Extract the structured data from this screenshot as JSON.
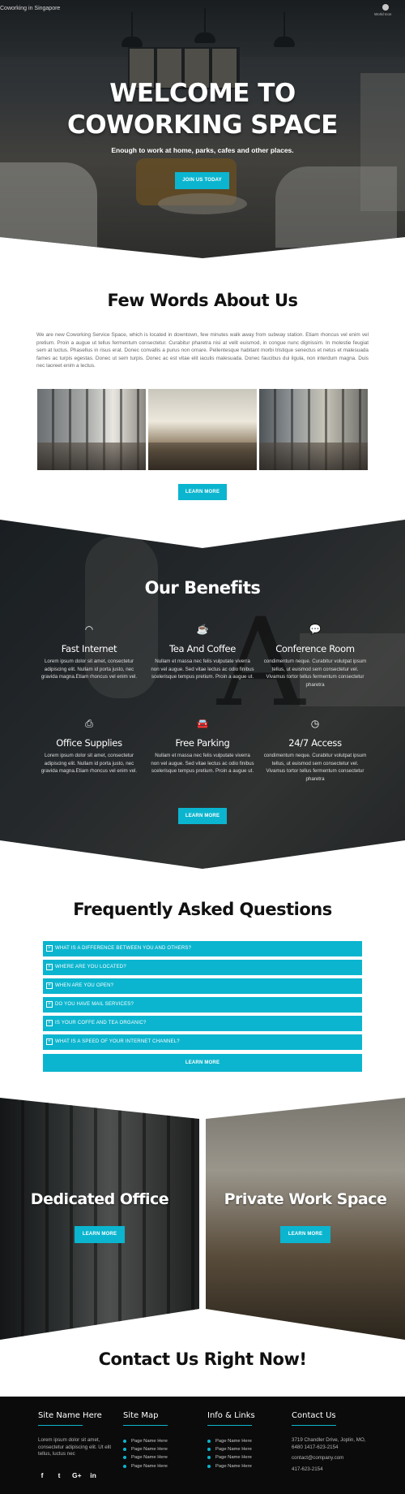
{
  "header": {
    "brand": "Coworking in Singapore",
    "top_icon_label": "World Icon"
  },
  "hero": {
    "title_line1": "WELCOME TO",
    "title_line2": "COWORKING SPACE",
    "subtitle": "Enough to work at home, parks, cafes and other places.",
    "button": "JOIN US TODAY"
  },
  "about": {
    "title": "Few Words About Us",
    "text": "We are new Coworking Service Space, which is located in downtown, few minutes walk away from subway station. Etiam rhoncus vel enim vel pretium. Proin a augue ut tellus fermentum consectetur. Curabitur pharetra nisi at velit euismod, in congue nunc dignissim. In molestie feugiat sem at luctus. Phasellus in risus erat. Donec convallis a purus non ornare. Pellentesque habitant morbi tristique senectus et netus et malesuada fames ac turpis egestas. Donec ut sem turpis. Donec ac est vitae elit iaculis malesuada. Donec faucibus dui ligula, non interdum magna. Duis nec laoreet enim a lectus.",
    "button": "LEARN MORE"
  },
  "benefits": {
    "title": "Our Benefits",
    "items": [
      {
        "icon": "wifi-icon",
        "glyph": "◠",
        "title": "Fast Internet",
        "text": "Lorem ipsum dolor sit amet, consectetur adipiscing elit. Nullam id porta justo, nec gravida magna.Etiam rhoncus vel enim vel."
      },
      {
        "icon": "coffee-icon",
        "glyph": "☕",
        "title": "Tea And Coffee",
        "text": "Nullam et massa nec felis vulputate viverra non vel augue. Sed vitae lectus ac odio finibus scelerisque tempus pretium. Proin a augue ut."
      },
      {
        "icon": "chat-icon",
        "glyph": "💬",
        "title": "Conference Room",
        "text": "condimentum neque. Curabitur volutpat ipsum tellus, ut euismod sem consectetur vel. Vivamus tortor tellus fermentum consectetur pharetra"
      },
      {
        "icon": "printer-icon",
        "glyph": "⎙",
        "title": "Office Supplies",
        "text": "Lorem ipsum dolor sit amet, consectetur adipiscing elit. Nullam id porta justo, nec gravida magna.Etiam rhoncus vel enim vel."
      },
      {
        "icon": "car-icon",
        "glyph": "🚘",
        "title": "Free Parking",
        "text": "Nullam et massa nec felis vulputate viverra non vel augue. Sed vitae lectus ac odio finibus scelerisque tempus pretium. Proin a augue ut."
      },
      {
        "icon": "clock-icon",
        "glyph": "◷",
        "title": "24/7 Access",
        "text": "condimentum neque. Curabitur volutpat ipsum tellus, ut euismod sem consectetur vel. Vivamus tortor tellus fermentum consectetur pharetra"
      }
    ],
    "button": "LEARN MORE"
  },
  "faq": {
    "title": "Frequently Asked Questions",
    "items": [
      "WHAT IS A DIFFERENCE BETWEEN YOU AND OTHERS?",
      "WHERE ARE YOU LOCATED?",
      "WHEN ARE YOU OPEN?",
      "DO YOU HAVE MAIL SERVICES?",
      "IS YOUR COFFE AND TEA ORGANIC?",
      "WHAT IS A SPEED OF YOUR INTERNET CHANNEL?"
    ],
    "toggle_glyph": "+",
    "button": "LEARN MORE"
  },
  "panels": {
    "left": {
      "title": "Dedicated Office",
      "button": "LEARN MORE"
    },
    "right": {
      "title": "Private Work Space",
      "button": "LEARN MORE"
    }
  },
  "contact": {
    "title": "Contact Us Right Now!"
  },
  "footer": {
    "col1": {
      "title": "Site Name Here",
      "text": "Lorem ipsum dolor sit amet, consectetur adipiscing elit. Ut elit tellus, luctus nec",
      "social": [
        "f",
        "t",
        "G+",
        "in"
      ]
    },
    "col2": {
      "title": "Site Map",
      "links": [
        "Page Name Here",
        "Page Name Here",
        "Page Name Here",
        "Page Name Here"
      ]
    },
    "col3": {
      "title": "Info & Links",
      "links": [
        "Page Name Here",
        "Page Name Here",
        "Page Name Here",
        "Page Name Here"
      ]
    },
    "col4": {
      "title": "Contact Us",
      "address": "3719 Chandler Drive, Joplin, MO, 6480 1417-623-2154",
      "email": "contact@company.com",
      "phone": "417-623-2154"
    }
  },
  "colors": {
    "accent": "#0bb5cf",
    "footer_bg": "#0b0b0b",
    "heading": "#111111"
  }
}
